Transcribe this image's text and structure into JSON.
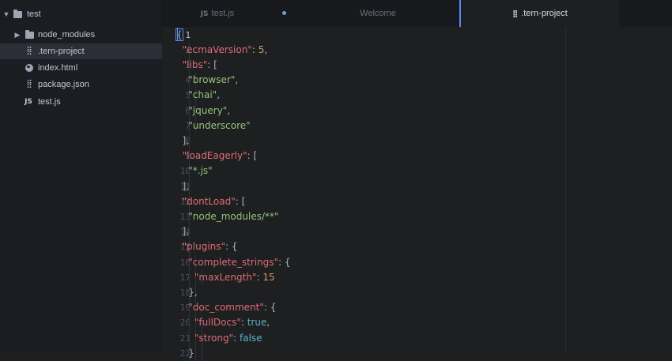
{
  "tree": {
    "root": "test",
    "items": [
      {
        "label": "node_modules",
        "icon": "folder-icon",
        "type": "folder",
        "expanded": false
      },
      {
        "label": ".tern-project",
        "icon": "settings-file-icon",
        "type": "file",
        "selected": true
      },
      {
        "label": "index.html",
        "icon": "globe-icon",
        "type": "file"
      },
      {
        "label": "package.json",
        "icon": "settings-file-icon",
        "type": "file"
      },
      {
        "label": "test.js",
        "icon": "js-icon",
        "type": "file"
      }
    ]
  },
  "tabs": [
    {
      "label": "test.js",
      "icon": "js-icon",
      "modified": true,
      "active": false
    },
    {
      "label": "Welcome",
      "active": false
    },
    {
      "label": ".tern-project",
      "icon": "settings-file-icon",
      "active": true
    }
  ],
  "tab_icons": {
    "js": "JS",
    "settings": "⣿"
  },
  "editor": {
    "current_line": 1,
    "line_numbers": [
      "1",
      "2",
      "3",
      "4",
      "5",
      "6",
      "7",
      "8",
      "9",
      "10",
      "11",
      "12",
      "13",
      "14",
      "15",
      "16",
      "17",
      "18",
      "19",
      "20",
      "21",
      "22"
    ],
    "lines": [
      [
        {
          "t": "{",
          "c": "p"
        }
      ],
      [
        {
          "t": "  "
        },
        {
          "t": "\"ecmaVersion\"",
          "c": "k"
        },
        {
          "t": ": ",
          "c": "p"
        },
        {
          "t": "5",
          "c": "n"
        },
        {
          "t": ",",
          "c": "p"
        }
      ],
      [
        {
          "t": "  "
        },
        {
          "t": "\"libs\"",
          "c": "k"
        },
        {
          "t": ": [",
          "c": "p"
        }
      ],
      [
        {
          "t": "    "
        },
        {
          "t": "\"browser\"",
          "c": "s"
        },
        {
          "t": ",",
          "c": "p"
        }
      ],
      [
        {
          "t": "    "
        },
        {
          "t": "\"chai\"",
          "c": "s"
        },
        {
          "t": ",",
          "c": "p"
        }
      ],
      [
        {
          "t": "    "
        },
        {
          "t": "\"jquery\"",
          "c": "s"
        },
        {
          "t": ",",
          "c": "p"
        }
      ],
      [
        {
          "t": "    "
        },
        {
          "t": "\"underscore\"",
          "c": "s"
        }
      ],
      [
        {
          "t": "  "
        },
        {
          "t": "],",
          "c": "p"
        }
      ],
      [
        {
          "t": "  "
        },
        {
          "t": "\"loadEagerly\"",
          "c": "k"
        },
        {
          "t": ": [",
          "c": "p"
        }
      ],
      [
        {
          "t": "    "
        },
        {
          "t": "\"*.js\"",
          "c": "s"
        }
      ],
      [
        {
          "t": "  "
        },
        {
          "t": "],",
          "c": "p"
        }
      ],
      [
        {
          "t": "  "
        },
        {
          "t": "\"dontLoad\"",
          "c": "k"
        },
        {
          "t": ": [",
          "c": "p"
        }
      ],
      [
        {
          "t": "    "
        },
        {
          "t": "\"node_modules/**\"",
          "c": "s"
        }
      ],
      [
        {
          "t": "  "
        },
        {
          "t": "],",
          "c": "p"
        }
      ],
      [
        {
          "t": "  "
        },
        {
          "t": "\"plugins\"",
          "c": "k"
        },
        {
          "t": ": {",
          "c": "p"
        }
      ],
      [
        {
          "t": "    "
        },
        {
          "t": "\"complete_strings\"",
          "c": "k"
        },
        {
          "t": ": {",
          "c": "p"
        }
      ],
      [
        {
          "t": "      "
        },
        {
          "t": "\"maxLength\"",
          "c": "k"
        },
        {
          "t": ": ",
          "c": "p"
        },
        {
          "t": "15",
          "c": "n"
        }
      ],
      [
        {
          "t": "    "
        },
        {
          "t": "},",
          "c": "p"
        }
      ],
      [
        {
          "t": "    "
        },
        {
          "t": "\"doc_comment\"",
          "c": "k"
        },
        {
          "t": ": {",
          "c": "p"
        }
      ],
      [
        {
          "t": "      "
        },
        {
          "t": "\"fullDocs\"",
          "c": "k"
        },
        {
          "t": ": ",
          "c": "p"
        },
        {
          "t": "true",
          "c": "b"
        },
        {
          "t": ",",
          "c": "p"
        }
      ],
      [
        {
          "t": "      "
        },
        {
          "t": "\"strong\"",
          "c": "k"
        },
        {
          "t": ": ",
          "c": "p"
        },
        {
          "t": "false",
          "c": "b"
        }
      ],
      [
        {
          "t": "    "
        },
        {
          "t": "}",
          "c": "p"
        }
      ]
    ]
  }
}
